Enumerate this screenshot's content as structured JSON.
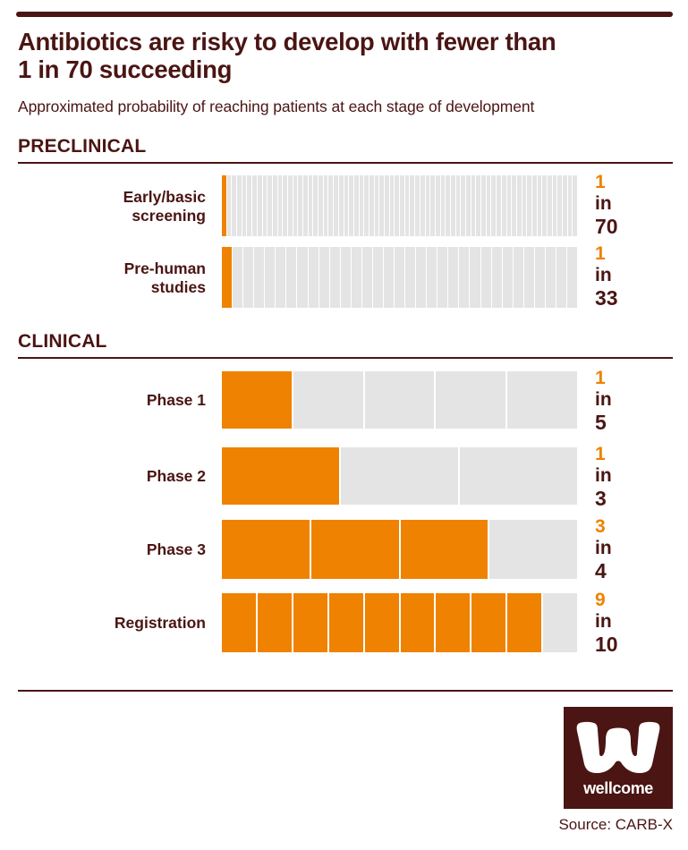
{
  "header": {
    "title_line1": "Antibiotics are risky to develop with fewer than",
    "title_line2": "1 in 70 succeeding",
    "subtitle": "Approximated probability of reaching patients at each stage of development"
  },
  "sections": {
    "preclinical": "PRECLINICAL",
    "clinical": "CLINICAL"
  },
  "rows": {
    "early": {
      "label_line1": "Early/basic",
      "label_line2": "screening",
      "numerator": "1",
      "in": "in",
      "denominator": "70"
    },
    "prehuman": {
      "label_line1": "Pre-human",
      "label_line2": "studies",
      "numerator": "1",
      "in": "in",
      "denominator": "33"
    },
    "phase1": {
      "label_line1": "Phase 1",
      "numerator": "1",
      "in": "in",
      "denominator": "5"
    },
    "phase2": {
      "label_line1": "Phase 2",
      "numerator": "1",
      "in": "in",
      "denominator": "3"
    },
    "phase3": {
      "label_line1": "Phase 3",
      "numerator": "3",
      "in": "in",
      "denominator": "4"
    },
    "registration": {
      "label_line1": "Registration",
      "numerator": "9",
      "in": "in",
      "denominator": "10"
    }
  },
  "footer": {
    "logo_word": "wellcome",
    "source": "Source: CARB-X"
  },
  "colors": {
    "accent_orange": "#ef8200",
    "dark_brown": "#4a1513",
    "track_grey": "#e4e4e4"
  },
  "chart_data": {
    "type": "bar",
    "title": "Antibiotics are risky to develop with fewer than 1 in 70 succeeding",
    "subtitle": "Approximated probability of reaching patients at each stage of development",
    "xlabel": "",
    "ylabel": "",
    "grid": false,
    "legend_position": "none",
    "note": "Each row is a whole-bar divided into `total` equal segments; `filled` segments are coloured orange, representing the probability numerator over denominator.",
    "groups": [
      {
        "name": "PRECLINICAL",
        "categories": [
          "Early/basic screening",
          "Pre-human studies"
        ],
        "values": [
          0.0143,
          0.0303
        ],
        "ratios": [
          "1 in 70",
          "1 in 33"
        ],
        "segments": [
          {
            "total": 70,
            "filled": 1
          },
          {
            "total": 33,
            "filled": 1
          }
        ]
      },
      {
        "name": "CLINICAL",
        "categories": [
          "Phase 1",
          "Phase 2",
          "Phase 3",
          "Registration"
        ],
        "values": [
          0.2,
          0.3333,
          0.75,
          0.9
        ],
        "ratios": [
          "1 in 5",
          "1 in 3",
          "3 in 4",
          "9 in 10"
        ],
        "segments": [
          {
            "total": 5,
            "filled": 1
          },
          {
            "total": 3,
            "filled": 1
          },
          {
            "total": 4,
            "filled": 3
          },
          {
            "total": 10,
            "filled": 9
          }
        ]
      }
    ]
  }
}
